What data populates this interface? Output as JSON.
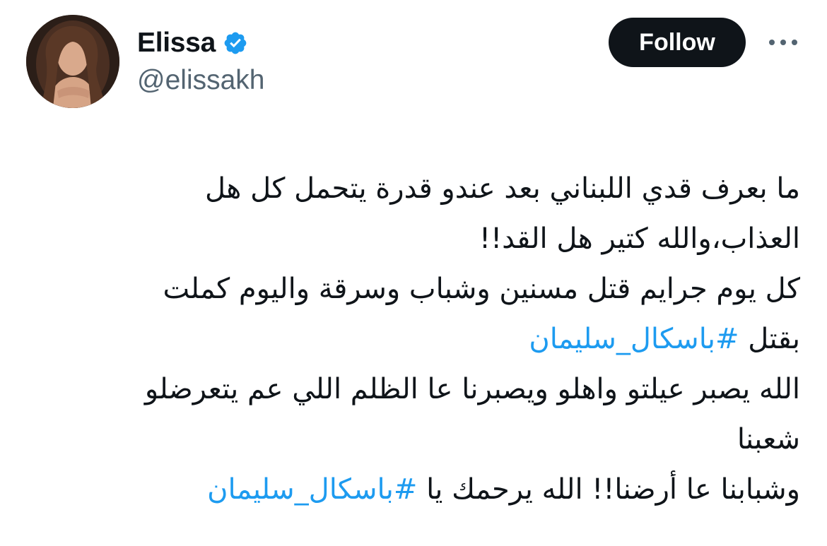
{
  "author": {
    "display_name": "Elissa",
    "handle": "@elissakh",
    "verified_icon": "verified-badge-icon",
    "avatar_alt": "profile photo"
  },
  "actions": {
    "follow_label": "Follow",
    "more_icon": "more-horizontal-icon"
  },
  "tweet": {
    "line_1": "ما بعرف قدي اللبناني بعد عندو قدرة يتحمل كل هل",
    "line_2": "العذاب،والله كتير هل القد!!",
    "line_3": "كل يوم جرايم قتل مسنين وشباب وسرقة واليوم كملت",
    "line_4_text": "بقتل ",
    "line_4_hashtag": "#باسكال_سليمان",
    "line_5": "الله يصبر عيلتو واهلو ويصبرنا عا الظلم اللي عم يتعرضلو",
    "line_6": "شعبنا",
    "line_7_text": "وشبابنا عا أرضنا!! الله يرحمك يا ",
    "line_7_hashtag": "#باسكال_سليمان"
  },
  "colors": {
    "text": "#0f1419",
    "secondary": "#536471",
    "link": "#1d9bf0",
    "verified": "#1d9bf0",
    "button_bg": "#0f1419",
    "button_text": "#ffffff"
  }
}
